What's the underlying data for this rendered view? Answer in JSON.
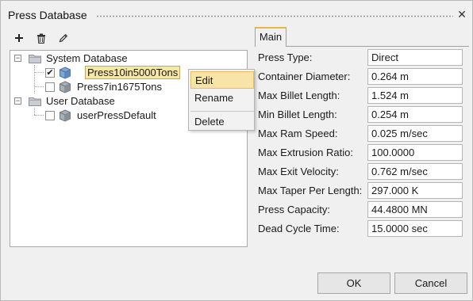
{
  "window": {
    "title": "Press Database"
  },
  "toolbar": {
    "add_icon": "plus-icon",
    "delete_icon": "trash-icon",
    "edit_icon": "pencil-icon"
  },
  "tree": {
    "nodes": [
      {
        "label": "System Database",
        "expander": "−",
        "icon": "folder-icon"
      },
      {
        "label": "Press10in5000Tons",
        "checked": true,
        "icon": "cube-icon",
        "selected": true
      },
      {
        "label": "Press7in1675Tons",
        "checked": false,
        "icon": "cube-icon"
      },
      {
        "label": "User Database",
        "expander": "−",
        "icon": "folder-icon"
      },
      {
        "label": "userPressDefault",
        "checked": false,
        "icon": "cube-icon"
      }
    ]
  },
  "context_menu": {
    "items": [
      {
        "label": "Edit",
        "highlighted": true
      },
      {
        "label": "Rename"
      },
      {
        "label": "Delete"
      }
    ]
  },
  "tabs": {
    "main": "Main"
  },
  "properties": [
    {
      "label": "Press Type:",
      "value": "Direct"
    },
    {
      "label": "Container Diameter:",
      "value": "0.264 m"
    },
    {
      "label": "Max Billet Length:",
      "value": "1.524 m"
    },
    {
      "label": "Min Billet Length:",
      "value": "0.254 m"
    },
    {
      "label": "Max Ram Speed:",
      "value": "0.025 m/sec"
    },
    {
      "label": "Max Extrusion Ratio:",
      "value": "100.0000"
    },
    {
      "label": "Max Exit Velocity:",
      "value": "0.762 m/sec"
    },
    {
      "label": "Max Taper Per Length:",
      "value": "297.000 K"
    },
    {
      "label": "Press Capacity:",
      "value": "44.4800 MN"
    },
    {
      "label": "Dead Cycle Time:",
      "value": "15.0000 sec"
    }
  ],
  "buttons": {
    "ok": "OK",
    "cancel": "Cancel"
  },
  "colors": {
    "selection": "#f6e7a8",
    "menu_highlight": "#f8e4a8",
    "tab_accent": "#e8b84a"
  }
}
